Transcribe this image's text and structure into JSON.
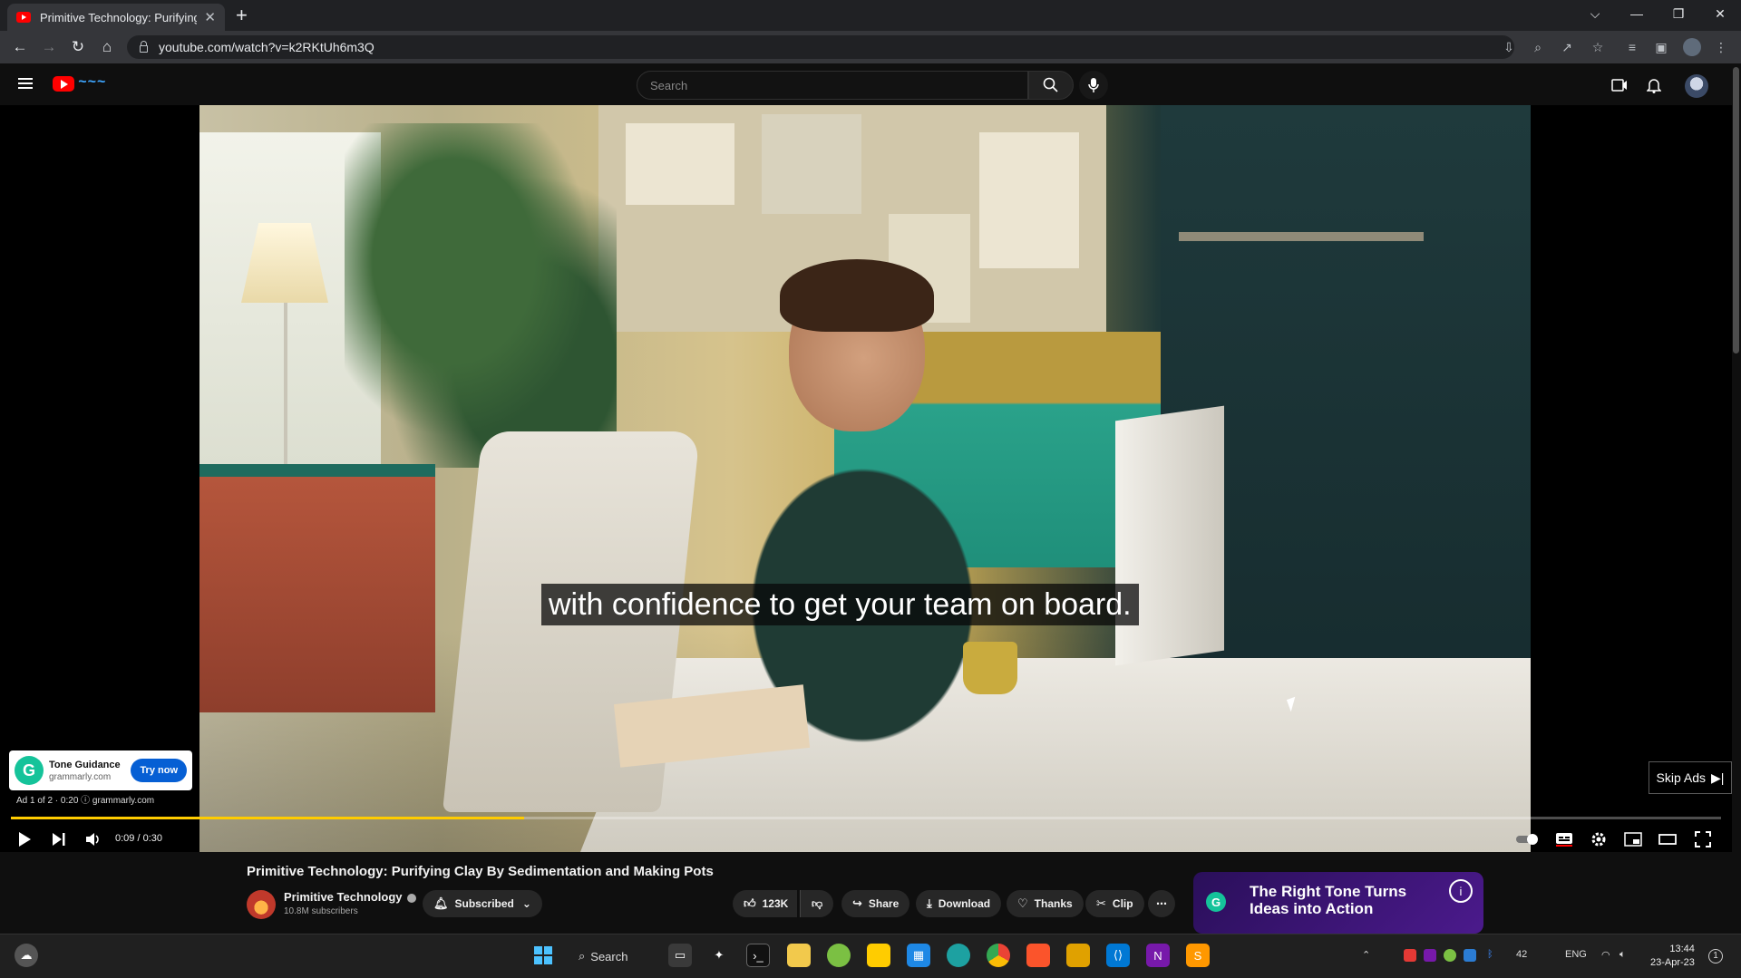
{
  "browser": {
    "tab_title": "Primitive Technology: Purifying C",
    "url": "youtube.com/watch?v=k2RKtUh6m3Q"
  },
  "youtube": {
    "search_placeholder": "Search"
  },
  "player": {
    "caption": "with confidence to get your team on board.",
    "time": "0:09 / 0:30",
    "progress": 0.3,
    "ad": {
      "title": "Tone Guidance",
      "domain": "grammarly.com",
      "cta": "Try now",
      "info": "Ad 1 of 2 · 0:20 ⓘ   grammarly.com",
      "skip": "Skip Ads"
    }
  },
  "video": {
    "title": "Primitive Technology: Purifying Clay By Sedimentation and Making Pots",
    "channel": "Primitive Technology",
    "subscribers": "10.8M subscribers",
    "subscribe_label": "Subscribed",
    "likes": "123K",
    "share_label": "Share",
    "download_label": "Download",
    "thanks_label": "Thanks",
    "clip_label": "Clip"
  },
  "banner_ad": {
    "text_line1": "The Right Tone Turns",
    "text_line2": "Ideas into Action"
  },
  "taskbar": {
    "search_label": "Search",
    "language": "ENG",
    "time": "13:44",
    "date": "23-Apr-23",
    "tray_temp": "42",
    "notification_count": "1"
  },
  "colors": {
    "youtube_red": "#ff0000",
    "progress_ad_yellow": "#ffcc00",
    "grammarly_green": "#15c39a",
    "cta_blue": "#065fd4"
  }
}
